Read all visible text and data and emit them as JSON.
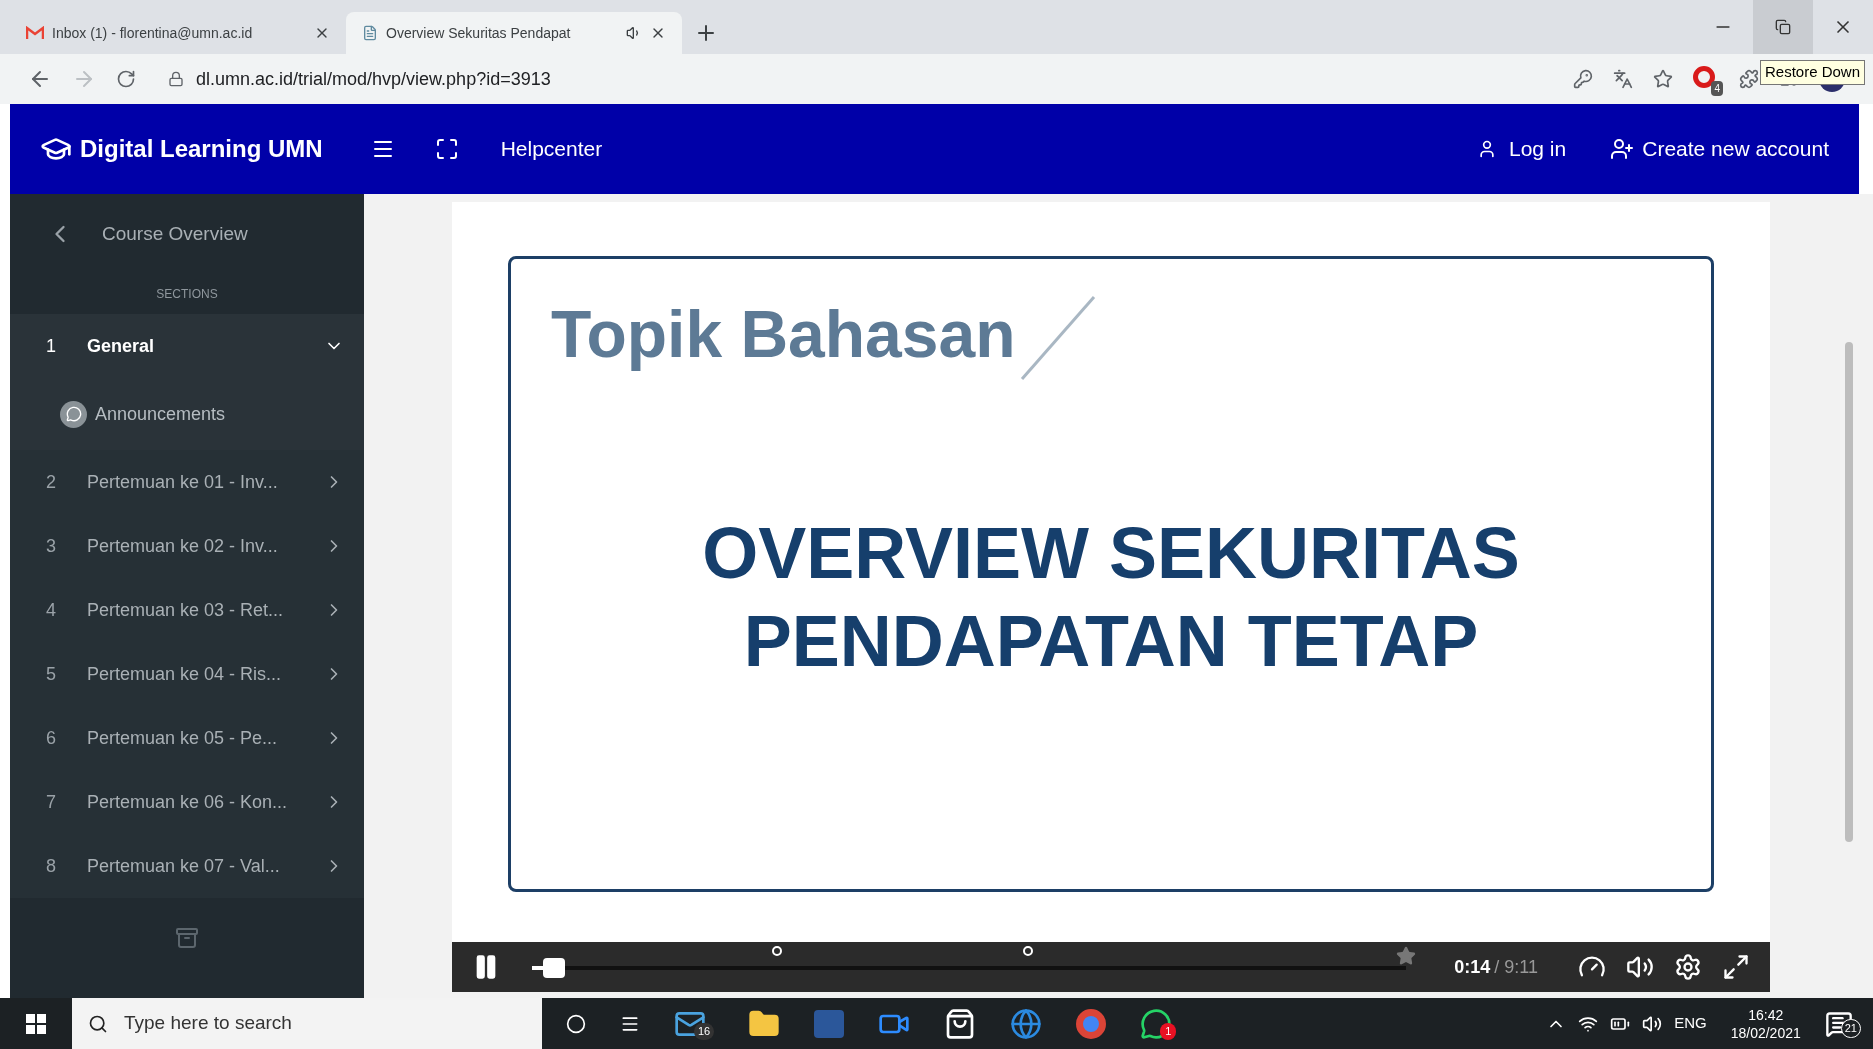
{
  "browser": {
    "tabs": [
      {
        "title": "Inbox (1) - florentina@umn.ac.id",
        "selected": false,
        "kind": "mail"
      },
      {
        "title": "Overview Sekuritas Pendapat",
        "selected": true,
        "kind": "page"
      }
    ],
    "address": "dl.umn.ac.id/trial/mod/hvp/view.php?id=3913",
    "extension_badge": "4",
    "tooltip": "Restore Down"
  },
  "header": {
    "brand": "Digital Learning UMN",
    "links": [
      "Helpcenter"
    ],
    "login": "Log in",
    "signup": "Create new account"
  },
  "sidebar": {
    "back": "Course Overview",
    "heading": "SECTIONS",
    "sections": [
      {
        "number": "1",
        "title": "General",
        "expanded": true,
        "children": [
          {
            "title": "Announcements"
          }
        ]
      },
      {
        "number": "2",
        "title": "Pertemuan ke 01 - Inv...",
        "expanded": false
      },
      {
        "number": "3",
        "title": "Pertemuan ke 02 - Inv...",
        "expanded": false
      },
      {
        "number": "4",
        "title": "Pertemuan ke 03 - Ret...",
        "expanded": false
      },
      {
        "number": "5",
        "title": "Pertemuan ke 04 - Ris...",
        "expanded": false
      },
      {
        "number": "6",
        "title": "Pertemuan ke 05 - Pe...",
        "expanded": false
      },
      {
        "number": "7",
        "title": "Pertemuan ke 06 - Kon...",
        "expanded": false
      },
      {
        "number": "8",
        "title": "Pertemuan ke 07 - Val...",
        "expanded": false
      }
    ]
  },
  "video": {
    "slide_heading": "Topik Bahasan",
    "slide_title": [
      "OVERVIEW SEKURITAS",
      "PENDAPATAN TETAP"
    ],
    "playing": true,
    "level": 0.025,
    "current_time": "0:14",
    "duration": "/ 9:11"
  },
  "taskbar": {
    "search_placeholder": "Type here to search",
    "mail_badge": "16",
    "chat_badge": "1",
    "language": "ENG",
    "time": "16:42",
    "date": "18/02/2021",
    "notifications": "21"
  }
}
